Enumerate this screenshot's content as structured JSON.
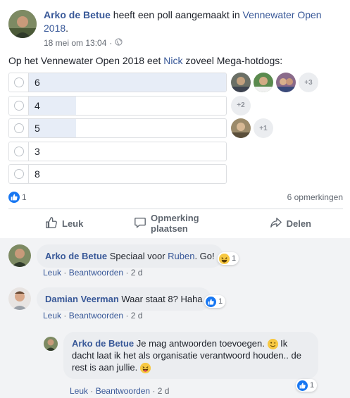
{
  "post": {
    "author": "Arko de Betue",
    "action_text": " heeft een poll aangemaakt in ",
    "group": "Vennewater Open 2018",
    "period": ".",
    "timestamp": "18 mei om 13:04",
    "meta_separator": "·",
    "question_before": "Op het Vennewater Open 2018 eet ",
    "question_mention": "Nick",
    "question_after": " zoveel Mega-hotdogs:"
  },
  "poll": {
    "options": [
      {
        "label": "6",
        "fill": 1.0,
        "more": "+3"
      },
      {
        "label": "4",
        "fill": 0.31,
        "more": "+2"
      },
      {
        "label": "5",
        "fill": 0.31,
        "more": "+1"
      },
      {
        "label": "3",
        "fill": 0,
        "more": ""
      },
      {
        "label": "8",
        "fill": 0,
        "more": ""
      }
    ]
  },
  "stats": {
    "likes": "1",
    "comments": "6 opmerkingen"
  },
  "actions": {
    "like": "Leuk",
    "comment": "Opmerking plaatsen",
    "share": "Delen"
  },
  "comments": [
    {
      "author": "Arko de Betue",
      "text_before": " Speciaal voor ",
      "mention": "Ruben",
      "text_after": ". Go!",
      "reaction_count": "1",
      "like": "Leuk",
      "reply": "Beantwoorden",
      "age": "2 d",
      "sep": "·"
    },
    {
      "author": "Damian Veerman",
      "text": " Waar staat 8? Haha",
      "reaction_count": "1",
      "like": "Leuk",
      "reply": "Beantwoorden",
      "age": "2 d",
      "sep": "·"
    },
    {
      "author": "Arko de Betue",
      "text_1": " Je mag antwoorden toevoegen. ",
      "text_2": " Ik dacht laat ik het als organisatie verantwoord houden.. de rest is aan jullie. ",
      "reaction_count": "1",
      "like": "Leuk",
      "reply": "Beantwoorden",
      "age": "2 d",
      "sep": "·"
    }
  ],
  "colors": {
    "link": "#385898",
    "like_blue": "#1877f2",
    "bar_fill": "#e7edf7",
    "comment_bg": "#ebedf0"
  }
}
